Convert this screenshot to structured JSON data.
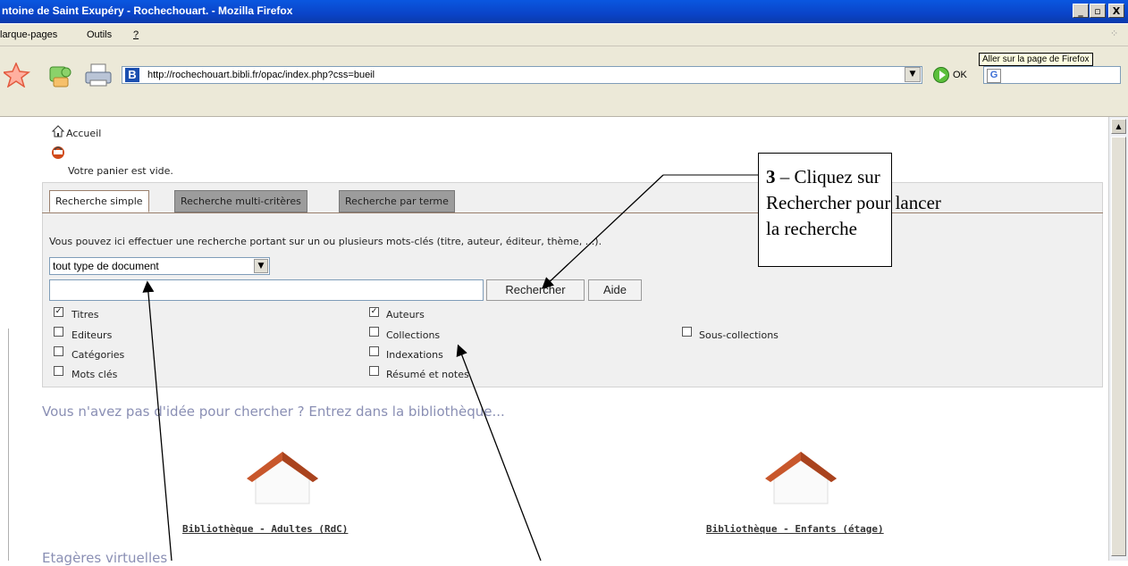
{
  "window": {
    "title": "ntoine de Saint Exupéry - Rochechouart. - Mozilla Firefox",
    "minimize": "_",
    "maximize": "▫",
    "close": "X"
  },
  "menu": {
    "items": [
      "larque-pages",
      "Outils",
      "?"
    ]
  },
  "toolbar": {
    "url": "http://rochechouart.bibli.fr/opac/index.php?css=bueil",
    "go_label": "OK",
    "tooltip": "Aller sur la page de Firefox"
  },
  "page": {
    "home_link": "Accueil",
    "basket_text": "Votre panier est vide.",
    "tabs": [
      "Recherche simple",
      "Recherche multi-critères",
      "Recherche par terme"
    ],
    "description": "Vous pouvez ici effectuer une recherche portant sur un ou plusieurs mots-clés (titre, auteur, éditeur, thème, ...).",
    "doc_type_selected": "tout type de document",
    "search_value": "",
    "search_button": "Rechercher",
    "help_button": "Aide",
    "checkboxes": [
      {
        "label": "Titres",
        "checked": true
      },
      {
        "label": "Auteurs",
        "checked": true
      },
      {
        "label": "Editeurs",
        "checked": false
      },
      {
        "label": "Collections",
        "checked": false
      },
      {
        "label": "Sous-collections",
        "checked": false
      },
      {
        "label": "Catégories",
        "checked": false
      },
      {
        "label": "Indexations",
        "checked": false
      },
      {
        "label": "Mots clés",
        "checked": false
      },
      {
        "label": "Résumé et notes",
        "checked": false
      }
    ],
    "enter_library": "Vous n'avez pas d'idée pour chercher ? Entrez dans la bibliothèque...",
    "libraries": [
      "Bibliothèque - Adultes (RdC)",
      "Bibliothèque - Enfants (étage)"
    ],
    "shelves_heading": "Etagères virtuelles"
  },
  "callout": {
    "number": "3",
    "line1": " – Cliquez sur",
    "line2": "Rechercher pour lancer",
    "line3": "la recherche"
  },
  "colors": {
    "titlebar": "#0a57e0",
    "chrome": "#ece9d8",
    "tab_inactive": "#9c9c9c",
    "heading": "#8a8fb4",
    "roof": "#c8572c"
  }
}
